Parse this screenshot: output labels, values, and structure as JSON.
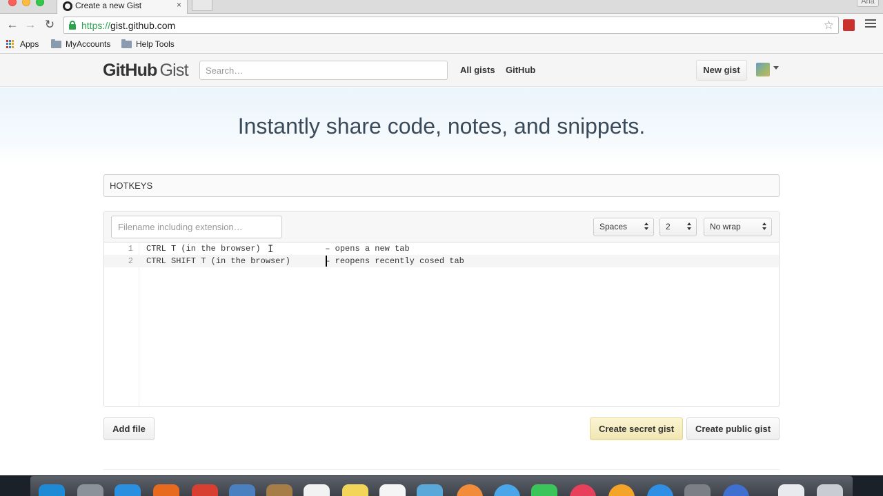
{
  "browser": {
    "tab_title": "Create a new Gist",
    "tab_close": "×",
    "profile_name": "Ana",
    "url_scheme": "https://",
    "url_host": "gist.github.com",
    "bookmarks": [
      {
        "label": "Apps"
      },
      {
        "label": "MyAccounts"
      },
      {
        "label": "Help Tools"
      }
    ]
  },
  "header": {
    "logo_bold": "GitHub",
    "logo_light": "Gist",
    "search_placeholder": "Search…",
    "nav": [
      {
        "label": "All gists"
      },
      {
        "label": "GitHub"
      }
    ],
    "new_gist_label": "New gist"
  },
  "hero": {
    "headline": "Instantly share code, notes, and snippets."
  },
  "gist": {
    "description_value": "HOTKEYS",
    "filename_placeholder": "Filename including extension…",
    "indent_mode": "Spaces",
    "indent_size": "2",
    "wrap_mode": "No wrap",
    "lines": [
      {
        "number": "1",
        "text": "CTRL T (in the browser)             – opens a new tab"
      },
      {
        "number": "2",
        "text": "CTRL SHIFT T (in the browser)       – reopens recently cosed tab"
      }
    ]
  },
  "actions": {
    "add_file": "Add file",
    "create_secret": "Create secret gist",
    "create_public": "Create public gist"
  },
  "colors": {
    "secure_green": "#2ea44f",
    "secret_button_bg": "#f1e6b2",
    "hero_gradient_top": "#eaf5fc"
  },
  "icons": [
    "github-octocat-icon",
    "close-icon",
    "back-arrow-icon",
    "forward-arrow-icon",
    "reload-icon",
    "lock-icon",
    "star-icon",
    "extension-icon",
    "chrome-menu-icon",
    "apps-grid-icon",
    "folder-icon",
    "avatar",
    "chevron-down-icon",
    "select-arrows-icon"
  ]
}
